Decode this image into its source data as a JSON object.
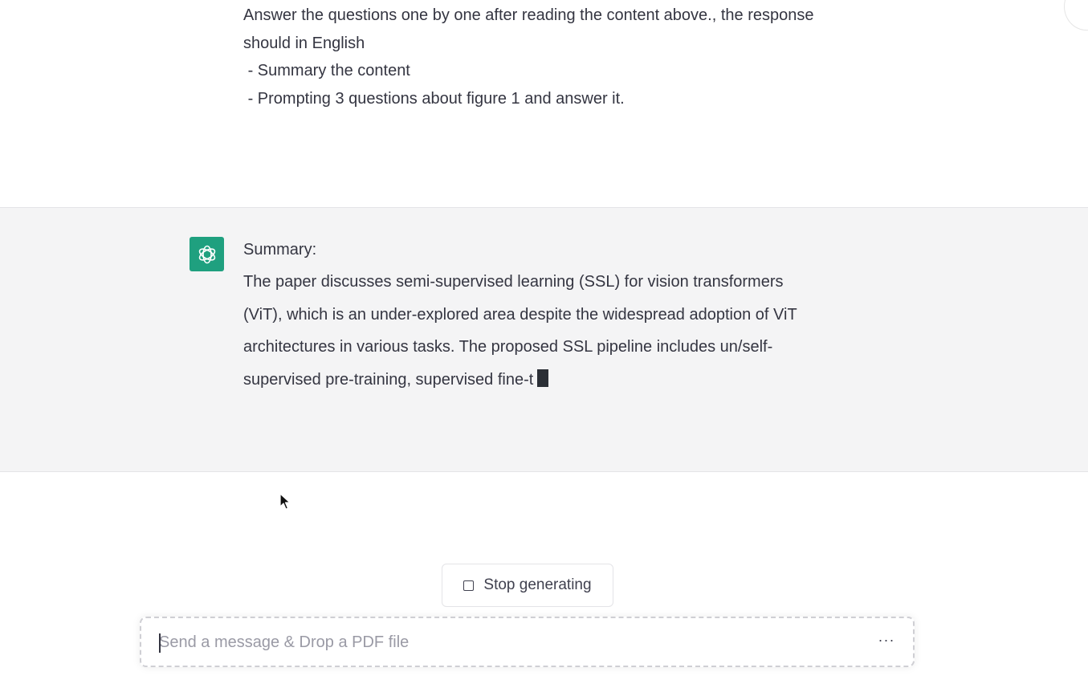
{
  "user_message": {
    "text": "Answer the questions one by one after reading the content above., the response should in English\n - Summary the content\n - Prompting 3 questions about figure 1 and answer it."
  },
  "assistant_message": {
    "avatar_icon": "openai-logo-icon",
    "avatar_color": "#1fa07f",
    "title": "Summary:",
    "body": "The paper discusses semi-supervised learning (SSL) for vision transformers (ViT), which is an under-explored area despite the widespread adoption of ViT architectures in various tasks. The proposed SSL pipeline includes un/self-supervised pre-training, supervised fine-t"
  },
  "controls": {
    "stop_label": "Stop generating",
    "stop_icon": "stop-square-icon"
  },
  "composer": {
    "placeholder": "Send a message & Drop a PDF file",
    "value": "",
    "more_icon": "more-dots-icon",
    "more_label": "···"
  }
}
